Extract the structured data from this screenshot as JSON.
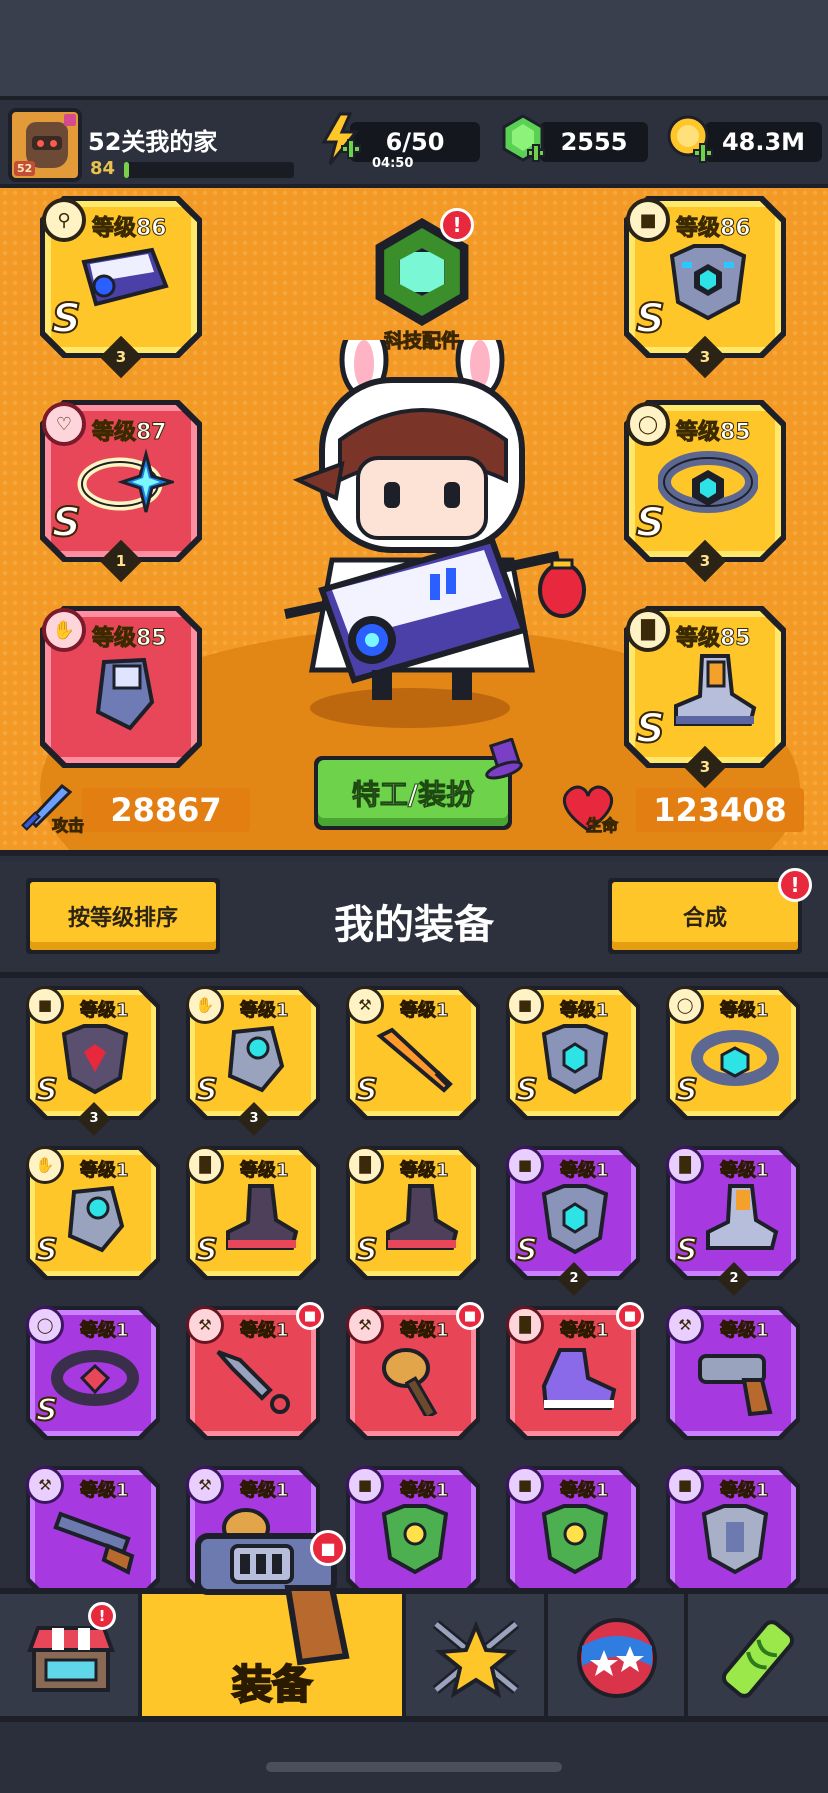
{
  "player": {
    "name": "52关我的家",
    "avatar_badge": "52",
    "level": "84",
    "xp_fraction": 0.03
  },
  "resources": {
    "energy": "6/50",
    "energy_timer": "04:50",
    "gems": "2555",
    "coins": "48.3M"
  },
  "hero": {
    "tech_parts_label": "科技配件",
    "tech_parts_alert": "!",
    "attack_label": "攻击",
    "attack_value": "28867",
    "hp_label": "生命",
    "hp_value": "123408",
    "agent_button": "特工/装扮",
    "slots": [
      {
        "id": "weapon",
        "level": "等级86",
        "rank": "S",
        "stars": "3",
        "rarity": "gold",
        "type_icon": "weapon-icon"
      },
      {
        "id": "necklace",
        "level": "等级87",
        "rank": "S",
        "stars": "1",
        "rarity": "red",
        "type_icon": "necklace-icon"
      },
      {
        "id": "gloves",
        "level": "等级85",
        "rank": "S",
        "stars": "",
        "rarity": "red",
        "type_icon": "glove-icon"
      },
      {
        "id": "armor",
        "level": "等级86",
        "rank": "S",
        "stars": "3",
        "rarity": "gold",
        "type_icon": "armor-icon"
      },
      {
        "id": "belt",
        "level": "等级85",
        "rank": "S",
        "stars": "3",
        "rarity": "gold",
        "type_icon": "belt-icon"
      },
      {
        "id": "boots",
        "level": "等级85",
        "rank": "S",
        "stars": "3",
        "rarity": "gold",
        "type_icon": "boot-icon"
      }
    ]
  },
  "equipment": {
    "title": "我的装备",
    "sort_button": "按等级排序",
    "merge_button": "合成",
    "merge_alert": "!",
    "items": [
      {
        "level": "等级1",
        "rank": "S",
        "stars": "3",
        "rarity": "gold",
        "type": "armor",
        "item": "dark-armor"
      },
      {
        "level": "等级1",
        "rank": "S",
        "stars": "3",
        "rarity": "gold",
        "type": "glove",
        "item": "mech-glove"
      },
      {
        "level": "等级1",
        "rank": "S",
        "stars": "",
        "rarity": "gold",
        "type": "weapon",
        "item": "sword"
      },
      {
        "level": "等级1",
        "rank": "S",
        "stars": "",
        "rarity": "gold",
        "type": "armor",
        "item": "mech-armor"
      },
      {
        "level": "等级1",
        "rank": "S",
        "stars": "",
        "rarity": "gold",
        "type": "belt",
        "item": "belt"
      },
      {
        "level": "等级1",
        "rank": "S",
        "stars": "",
        "rarity": "gold",
        "type": "glove",
        "item": "mech-glove"
      },
      {
        "level": "等级1",
        "rank": "S",
        "stars": "",
        "rarity": "gold",
        "type": "boot",
        "item": "dark-boot"
      },
      {
        "level": "等级1",
        "rank": "S",
        "stars": "",
        "rarity": "gold",
        "type": "boot",
        "item": "dark-boot"
      },
      {
        "level": "等级1",
        "rank": "S",
        "stars": "2",
        "rarity": "purple",
        "type": "armor",
        "item": "mech-armor"
      },
      {
        "level": "等级1",
        "rank": "S",
        "stars": "2",
        "rarity": "purple",
        "type": "boot",
        "item": "mech-boot"
      },
      {
        "level": "等级1",
        "rank": "S",
        "stars": "",
        "rarity": "purple",
        "type": "belt",
        "item": "red-belt"
      },
      {
        "level": "等级1",
        "rank": "",
        "stars": "",
        "rarity": "red",
        "type": "weapon",
        "item": "kunai",
        "new": true
      },
      {
        "level": "等级1",
        "rank": "",
        "stars": "",
        "rarity": "red",
        "type": "weapon",
        "item": "mace",
        "new": true
      },
      {
        "level": "等级1",
        "rank": "",
        "stars": "",
        "rarity": "red",
        "type": "boot",
        "item": "sneaker",
        "new": true
      },
      {
        "level": "等级1",
        "rank": "",
        "stars": "",
        "rarity": "purple",
        "type": "weapon",
        "item": "revolver"
      },
      {
        "level": "等级1",
        "rank": "",
        "stars": "",
        "rarity": "purple",
        "type": "weapon",
        "item": "shotgun"
      },
      {
        "level": "等级1",
        "rank": "",
        "stars": "",
        "rarity": "purple",
        "type": "weapon",
        "item": "mace"
      },
      {
        "level": "等级1",
        "rank": "",
        "stars": "",
        "rarity": "purple",
        "type": "armor",
        "item": "leaf-armor"
      },
      {
        "level": "等级1",
        "rank": "",
        "stars": "",
        "rarity": "purple",
        "type": "armor",
        "item": "leaf-armor"
      },
      {
        "level": "等级1",
        "rank": "",
        "stars": "",
        "rarity": "purple",
        "type": "armor",
        "item": "steel-armor"
      }
    ]
  },
  "nav": {
    "tabs": [
      {
        "id": "shop",
        "label": "",
        "icon": "shop-icon",
        "alert": "!"
      },
      {
        "id": "equipment",
        "label": "装备",
        "icon": "revolver-icon",
        "active": true
      },
      {
        "id": "battle",
        "label": "",
        "icon": "star-swords-icon"
      },
      {
        "id": "talent",
        "label": "",
        "icon": "star-ball-icon"
      },
      {
        "id": "evolve",
        "label": "",
        "icon": "dna-tube-icon"
      }
    ]
  },
  "colors": {
    "gold": "#ffc62a",
    "purple": "#a63ae0",
    "red": "#e84657",
    "hero_bg": "#f39a26",
    "green_button": "#6fd24b"
  }
}
